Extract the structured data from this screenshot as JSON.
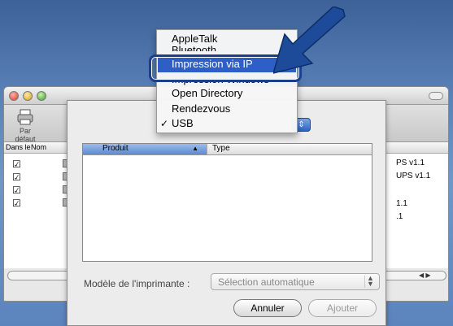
{
  "window": {
    "toolbar_label": "Par défaut",
    "columns": {
      "in": "Dans le",
      "name": "Nom"
    },
    "right_texts": [
      "PS v1.1",
      "UPS v1.1",
      "1.1",
      ".1"
    ]
  },
  "sheet": {
    "table": {
      "col_product": "Produit",
      "col_type": "Type"
    },
    "model_label": "Modèle de l'imprimante :",
    "model_value": "Sélection automatique",
    "cancel_label": "Annuler",
    "add_label": "Ajouter"
  },
  "menu": {
    "items": [
      "AppleTalk",
      "Bluetooth",
      "Impression via IP",
      "Impression Windows",
      "Open Directory",
      "Rendezvous",
      "USB"
    ],
    "selected_index": 2,
    "checked_label": "USB"
  },
  "colors": {
    "highlight": "#2d5fc7",
    "arrow": "#1e4a9a"
  },
  "icons": [
    "printer-icon",
    "checkmark-icon",
    "sort-ascending-icon",
    "popup-arrows-icon",
    "callout-arrow-icon"
  ]
}
